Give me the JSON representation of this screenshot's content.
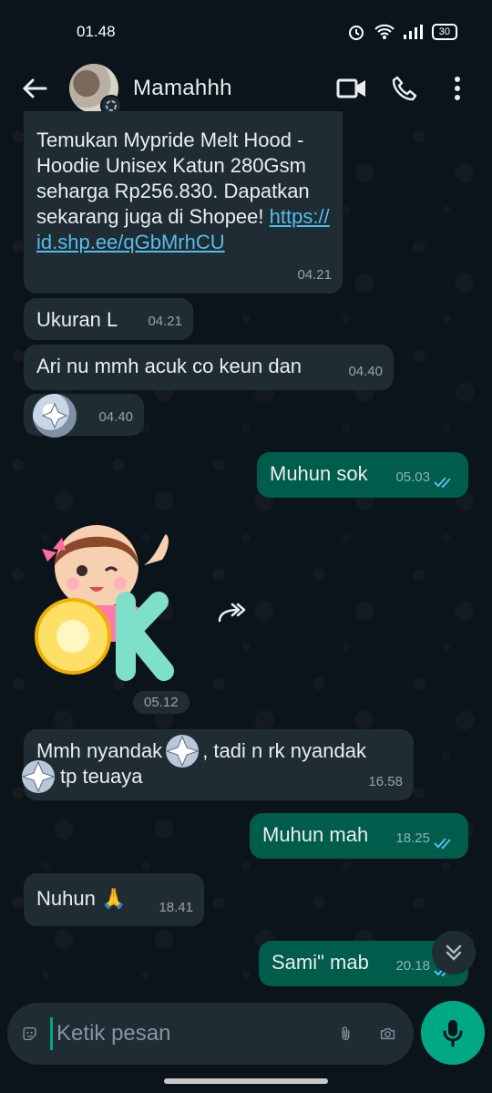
{
  "status_bar": {
    "time": "01.48",
    "battery": "30"
  },
  "header": {
    "contact_name": "Mamahhh"
  },
  "messages": [
    {
      "text": "Temukan Mypride Melt Hood - Hoodie Unisex Katun 280Gsm seharga Rp256.830. Dapatkan sekarang juga di Shopee! ",
      "link": "https://id.shp.ee/qGbMrhCU",
      "time": "04.21"
    },
    {
      "text": "Ukuran L",
      "time": "04.21"
    },
    {
      "text": "Ari nu mmh acuk co keun dan",
      "time": "04.40"
    },
    {
      "text": "",
      "time": "04.40"
    },
    {
      "text": "Muhun sok",
      "time": "05.03"
    },
    {
      "sticker_text": "OK",
      "time": "05.12"
    },
    {
      "text_a": "Mmh nyandak",
      "text_b": ", tadi n rk nyandak",
      "text_c": "tp teuaya",
      "time": "16.58"
    },
    {
      "text": "Muhun mah",
      "time": "18.25"
    },
    {
      "text": "Nuhun 🙏",
      "time": "18.41"
    },
    {
      "text": "Sami\" mab",
      "time": "20.18"
    }
  ],
  "input": {
    "placeholder": "Ketik pesan"
  },
  "colors": {
    "incoming": "#202c33",
    "outgoing": "#005c4b",
    "accent": "#00a884",
    "link": "#53bdeb",
    "read_tick": "#53bdeb"
  }
}
